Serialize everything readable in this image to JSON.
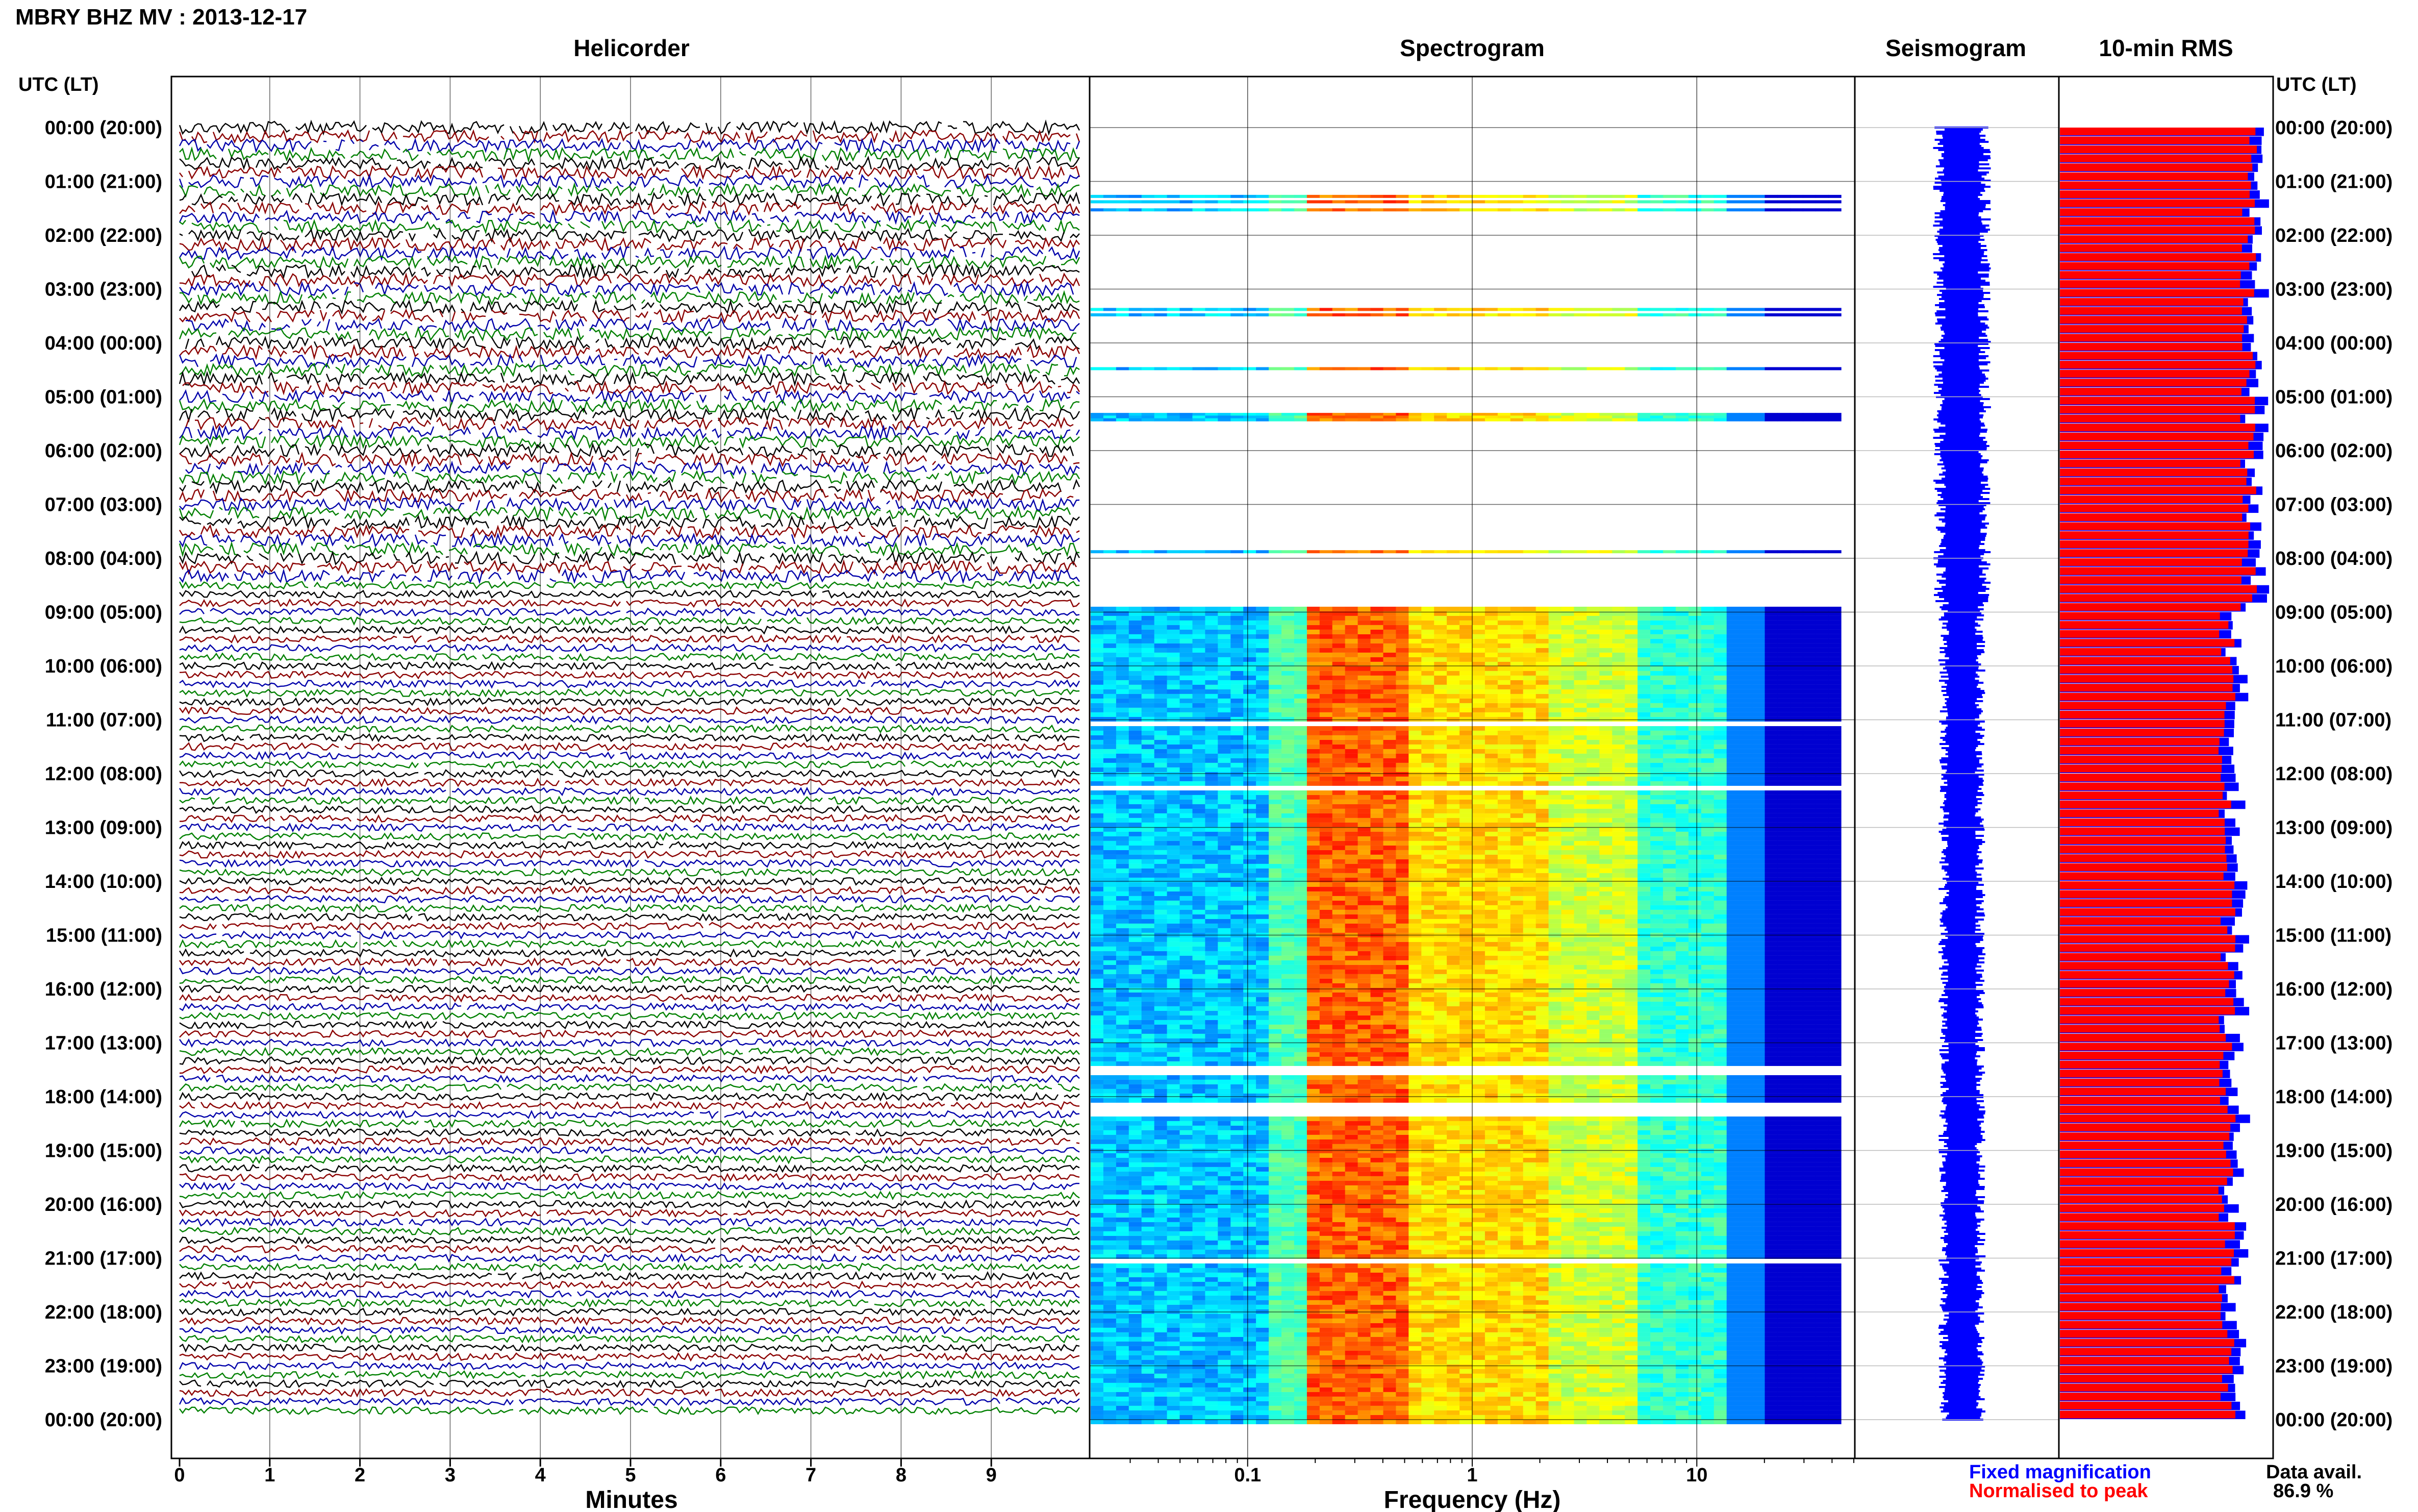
{
  "header": {
    "title": "MBRY BHZ MV : 2013-12-17",
    "time_label_left": "UTC (LT)",
    "time_label_right": "UTC (LT)"
  },
  "panels": {
    "helicorder": "Helicorder",
    "spectrogram": "Spectrogram",
    "seismogram": "Seismogram",
    "rms": "10-min RMS"
  },
  "axes": {
    "helicorder_xlabel": "Minutes",
    "helicorder_ticks": [
      "0",
      "1",
      "2",
      "3",
      "4",
      "5",
      "6",
      "7",
      "8",
      "9"
    ],
    "spectrogram_xlabel": "Frequency (Hz)",
    "spectrogram_ticks": [
      "0.1",
      "1",
      "10"
    ]
  },
  "time_labels": [
    "00:00 (20:00)",
    "01:00 (21:00)",
    "02:00 (22:00)",
    "03:00 (23:00)",
    "04:00 (00:00)",
    "05:00 (01:00)",
    "06:00 (02:00)",
    "07:00 (03:00)",
    "08:00 (04:00)",
    "09:00 (05:00)",
    "10:00 (06:00)",
    "11:00 (07:00)",
    "12:00 (08:00)",
    "13:00 (09:00)",
    "14:00 (10:00)",
    "15:00 (11:00)",
    "16:00 (12:00)",
    "17:00 (13:00)",
    "18:00 (14:00)",
    "19:00 (15:00)",
    "20:00 (16:00)",
    "21:00 (17:00)",
    "22:00 (18:00)",
    "23:00 (19:00)",
    "00:00 (20:00)"
  ],
  "legend": {
    "fixed": "Fixed magnification",
    "normalised": "Normalised to peak",
    "fixed_color": "#0000ff",
    "normalised_color": "#ff0000"
  },
  "data_avail": {
    "label": "Data avail.",
    "value": "86.9 %"
  },
  "helicorder_colors": [
    "#000000",
    "#8b0000",
    "#0000aa",
    "#008000"
  ],
  "chart_data": {
    "type": "heatmap",
    "xlim_minutes": [
      0,
      10
    ],
    "spectrogram_xlim_hz": [
      0.02,
      50
    ],
    "spectrogram_scale": "log",
    "rms_color": "#ff0000",
    "rms_outline_color": "#0000ff"
  }
}
